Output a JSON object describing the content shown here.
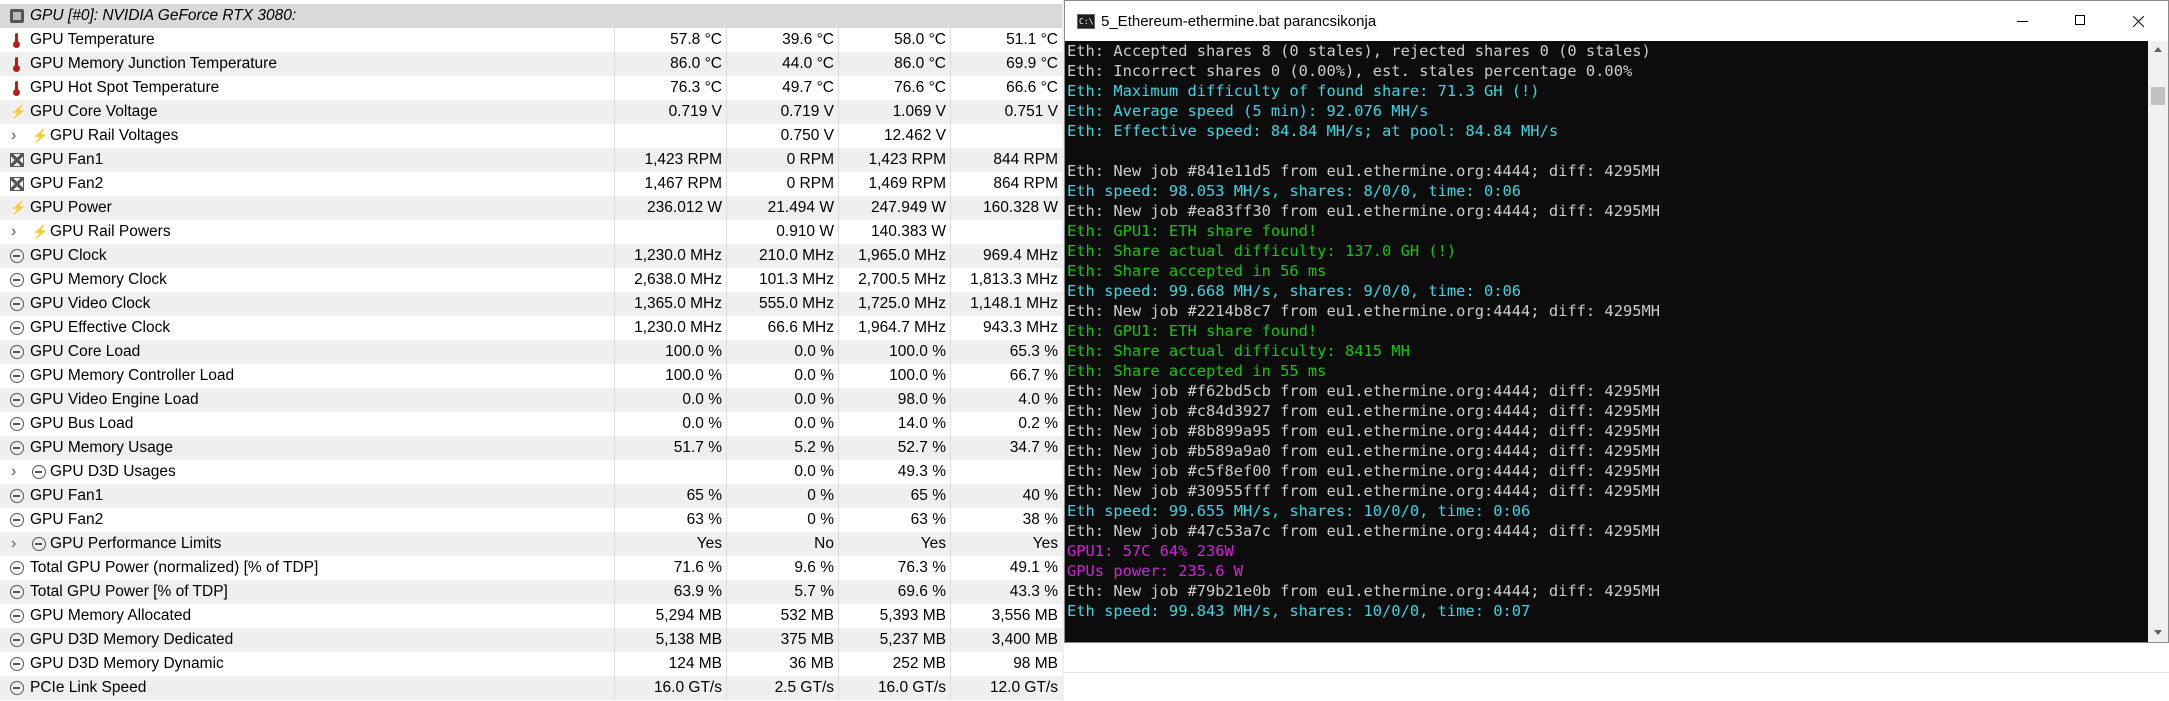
{
  "sensor_header": {
    "title": "GPU [#0]: NVIDIA GeForce RTX 3080:",
    "icon": "gpu-chip-icon"
  },
  "sensors": [
    {
      "name": "GPU Temperature",
      "icon": "thermometer-icon",
      "values": [
        "57.8 °C",
        "39.6 °C",
        "58.0 °C",
        "51.1 °C"
      ]
    },
    {
      "name": "GPU Memory Junction Temperature",
      "icon": "thermometer-icon",
      "values": [
        "86.0 °C",
        "44.0 °C",
        "86.0 °C",
        "69.9 °C"
      ]
    },
    {
      "name": "GPU Hot Spot Temperature",
      "icon": "thermometer-icon",
      "values": [
        "76.3 °C",
        "49.7 °C",
        "76.6 °C",
        "66.6 °C"
      ]
    },
    {
      "name": "GPU Core Voltage",
      "icon": "lightning-icon",
      "values": [
        "0.719 V",
        "0.719 V",
        "1.069 V",
        "0.751 V"
      ]
    },
    {
      "name": "GPU Rail Voltages",
      "icon": "lightning-icon",
      "expandable": true,
      "values": [
        "",
        "0.750 V",
        "12.462 V",
        ""
      ]
    },
    {
      "name": "GPU Fan1",
      "icon": "fan-icon",
      "values": [
        "1,423 RPM",
        "0 RPM",
        "1,423 RPM",
        "844 RPM"
      ]
    },
    {
      "name": "GPU Fan2",
      "icon": "fan-icon",
      "values": [
        "1,467 RPM",
        "0 RPM",
        "1,469 RPM",
        "864 RPM"
      ]
    },
    {
      "name": "GPU Power",
      "icon": "lightning-icon",
      "values": [
        "236.012 W",
        "21.494 W",
        "247.949 W",
        "160.328 W"
      ]
    },
    {
      "name": "GPU Rail Powers",
      "icon": "lightning-icon",
      "expandable": true,
      "values": [
        "",
        "0.910 W",
        "140.383 W",
        ""
      ]
    },
    {
      "name": "GPU Clock",
      "icon": "clock-icon",
      "values": [
        "1,230.0 MHz",
        "210.0 MHz",
        "1,965.0 MHz",
        "969.4 MHz"
      ]
    },
    {
      "name": "GPU Memory Clock",
      "icon": "clock-icon",
      "values": [
        "2,638.0 MHz",
        "101.3 MHz",
        "2,700.5 MHz",
        "1,813.3 MHz"
      ]
    },
    {
      "name": "GPU Video Clock",
      "icon": "clock-icon",
      "values": [
        "1,365.0 MHz",
        "555.0 MHz",
        "1,725.0 MHz",
        "1,148.1 MHz"
      ]
    },
    {
      "name": "GPU Effective Clock",
      "icon": "clock-icon",
      "values": [
        "1,230.0 MHz",
        "66.6 MHz",
        "1,964.7 MHz",
        "943.3 MHz"
      ]
    },
    {
      "name": "GPU Core Load",
      "icon": "clock-icon",
      "values": [
        "100.0 %",
        "0.0 %",
        "100.0 %",
        "65.3 %"
      ]
    },
    {
      "name": "GPU Memory Controller Load",
      "icon": "clock-icon",
      "values": [
        "100.0 %",
        "0.0 %",
        "100.0 %",
        "66.7 %"
      ]
    },
    {
      "name": "GPU Video Engine Load",
      "icon": "clock-icon",
      "values": [
        "0.0 %",
        "0.0 %",
        "98.0 %",
        "4.0 %"
      ]
    },
    {
      "name": "GPU Bus Load",
      "icon": "clock-icon",
      "values": [
        "0.0 %",
        "0.0 %",
        "14.0 %",
        "0.2 %"
      ]
    },
    {
      "name": "GPU Memory Usage",
      "icon": "clock-icon",
      "values": [
        "51.7 %",
        "5.2 %",
        "52.7 %",
        "34.7 %"
      ]
    },
    {
      "name": "GPU D3D Usages",
      "icon": "clock-icon",
      "expandable": true,
      "values": [
        "",
        "0.0 %",
        "49.3 %",
        ""
      ]
    },
    {
      "name": "GPU Fan1",
      "icon": "clock-icon",
      "values": [
        "65 %",
        "0 %",
        "65 %",
        "40 %"
      ]
    },
    {
      "name": "GPU Fan2",
      "icon": "clock-icon",
      "values": [
        "63 %",
        "0 %",
        "63 %",
        "38 %"
      ]
    },
    {
      "name": "GPU Performance Limits",
      "icon": "clock-icon",
      "expandable": true,
      "values": [
        "Yes",
        "No",
        "Yes",
        "Yes"
      ]
    },
    {
      "name": "Total GPU Power (normalized) [% of TDP]",
      "icon": "clock-icon",
      "values": [
        "71.6 %",
        "9.6 %",
        "76.3 %",
        "49.1 %"
      ]
    },
    {
      "name": "Total GPU Power [% of TDP]",
      "icon": "clock-icon",
      "values": [
        "63.9 %",
        "5.7 %",
        "69.6 %",
        "43.3 %"
      ]
    },
    {
      "name": "GPU Memory Allocated",
      "icon": "clock-icon",
      "values": [
        "5,294 MB",
        "532 MB",
        "5,393 MB",
        "3,556 MB"
      ]
    },
    {
      "name": "GPU D3D Memory Dedicated",
      "icon": "clock-icon",
      "values": [
        "5,138 MB",
        "375 MB",
        "5,237 MB",
        "3,400 MB"
      ]
    },
    {
      "name": "GPU D3D Memory Dynamic",
      "icon": "clock-icon",
      "values": [
        "124 MB",
        "36 MB",
        "252 MB",
        "98 MB"
      ]
    },
    {
      "name": "PCIe Link Speed",
      "icon": "clock-icon",
      "values": [
        "16.0 GT/s",
        "2.5 GT/s",
        "16.0 GT/s",
        "12.0 GT/s"
      ]
    }
  ],
  "console": {
    "title": "5_Ethereum-ethermine.bat parancsikonja",
    "colors": {
      "white": "#cccccc",
      "cyan": "#3ad6e2",
      "green": "#16c60c",
      "magenta": "#d222d8",
      "background": "#0c0c0c"
    },
    "lines": [
      {
        "text": "Eth: Accepted shares 8 (0 stales), rejected shares 0 (0 stales)",
        "color": "white"
      },
      {
        "text": "Eth: Incorrect shares 0 (0.00%), est. stales percentage 0.00%",
        "color": "white"
      },
      {
        "text": "Eth: Maximum difficulty of found share: 71.3 GH (!)",
        "color": "cyan"
      },
      {
        "text": "Eth: Average speed (5 min): 92.076 MH/s",
        "color": "cyan"
      },
      {
        "text": "Eth: Effective speed: 84.84 MH/s; at pool: 84.84 MH/s",
        "color": "cyan"
      },
      {
        "text": "",
        "color": "white"
      },
      {
        "text": "Eth: New job #841e11d5 from eu1.ethermine.org:4444; diff: 4295MH",
        "color": "white"
      },
      {
        "text": "Eth speed: 98.053 MH/s, shares: 8/0/0, time: 0:06",
        "color": "cyan"
      },
      {
        "text": "Eth: New job #ea83ff30 from eu1.ethermine.org:4444; diff: 4295MH",
        "color": "white"
      },
      {
        "text": "Eth: GPU1: ETH share found!",
        "color": "green"
      },
      {
        "text": "Eth: Share actual difficulty: 137.0 GH (!)",
        "color": "green"
      },
      {
        "text": "Eth: Share accepted in 56 ms",
        "color": "green"
      },
      {
        "text": "Eth speed: 99.668 MH/s, shares: 9/0/0, time: 0:06",
        "color": "cyan"
      },
      {
        "text": "Eth: New job #2214b8c7 from eu1.ethermine.org:4444; diff: 4295MH",
        "color": "white"
      },
      {
        "text": "Eth: GPU1: ETH share found!",
        "color": "green"
      },
      {
        "text": "Eth: Share actual difficulty: 8415 MH",
        "color": "green"
      },
      {
        "text": "Eth: Share accepted in 55 ms",
        "color": "green"
      },
      {
        "text": "Eth: New job #f62bd5cb from eu1.ethermine.org:4444; diff: 4295MH",
        "color": "white"
      },
      {
        "text": "Eth: New job #c84d3927 from eu1.ethermine.org:4444; diff: 4295MH",
        "color": "white"
      },
      {
        "text": "Eth: New job #8b899a95 from eu1.ethermine.org:4444; diff: 4295MH",
        "color": "white"
      },
      {
        "text": "Eth: New job #b589a9a0 from eu1.ethermine.org:4444; diff: 4295MH",
        "color": "white"
      },
      {
        "text": "Eth: New job #c5f8ef00 from eu1.ethermine.org:4444; diff: 4295MH",
        "color": "white"
      },
      {
        "text": "Eth: New job #30955fff from eu1.ethermine.org:4444; diff: 4295MH",
        "color": "white"
      },
      {
        "text": "Eth speed: 99.655 MH/s, shares: 10/0/0, time: 0:06",
        "color": "cyan"
      },
      {
        "text": "Eth: New job #47c53a7c from eu1.ethermine.org:4444; diff: 4295MH",
        "color": "white"
      },
      {
        "text": "GPU1: 57C 64% 236W",
        "color": "magenta"
      },
      {
        "text": "GPUs power: 235.6 W",
        "color": "magenta"
      },
      {
        "text": "Eth: New job #79b21e0b from eu1.ethermine.org:4444; diff: 4295MH",
        "color": "white"
      },
      {
        "text": "Eth speed: 99.843 MH/s, shares: 10/0/0, time: 0:07",
        "color": "cyan"
      }
    ]
  }
}
